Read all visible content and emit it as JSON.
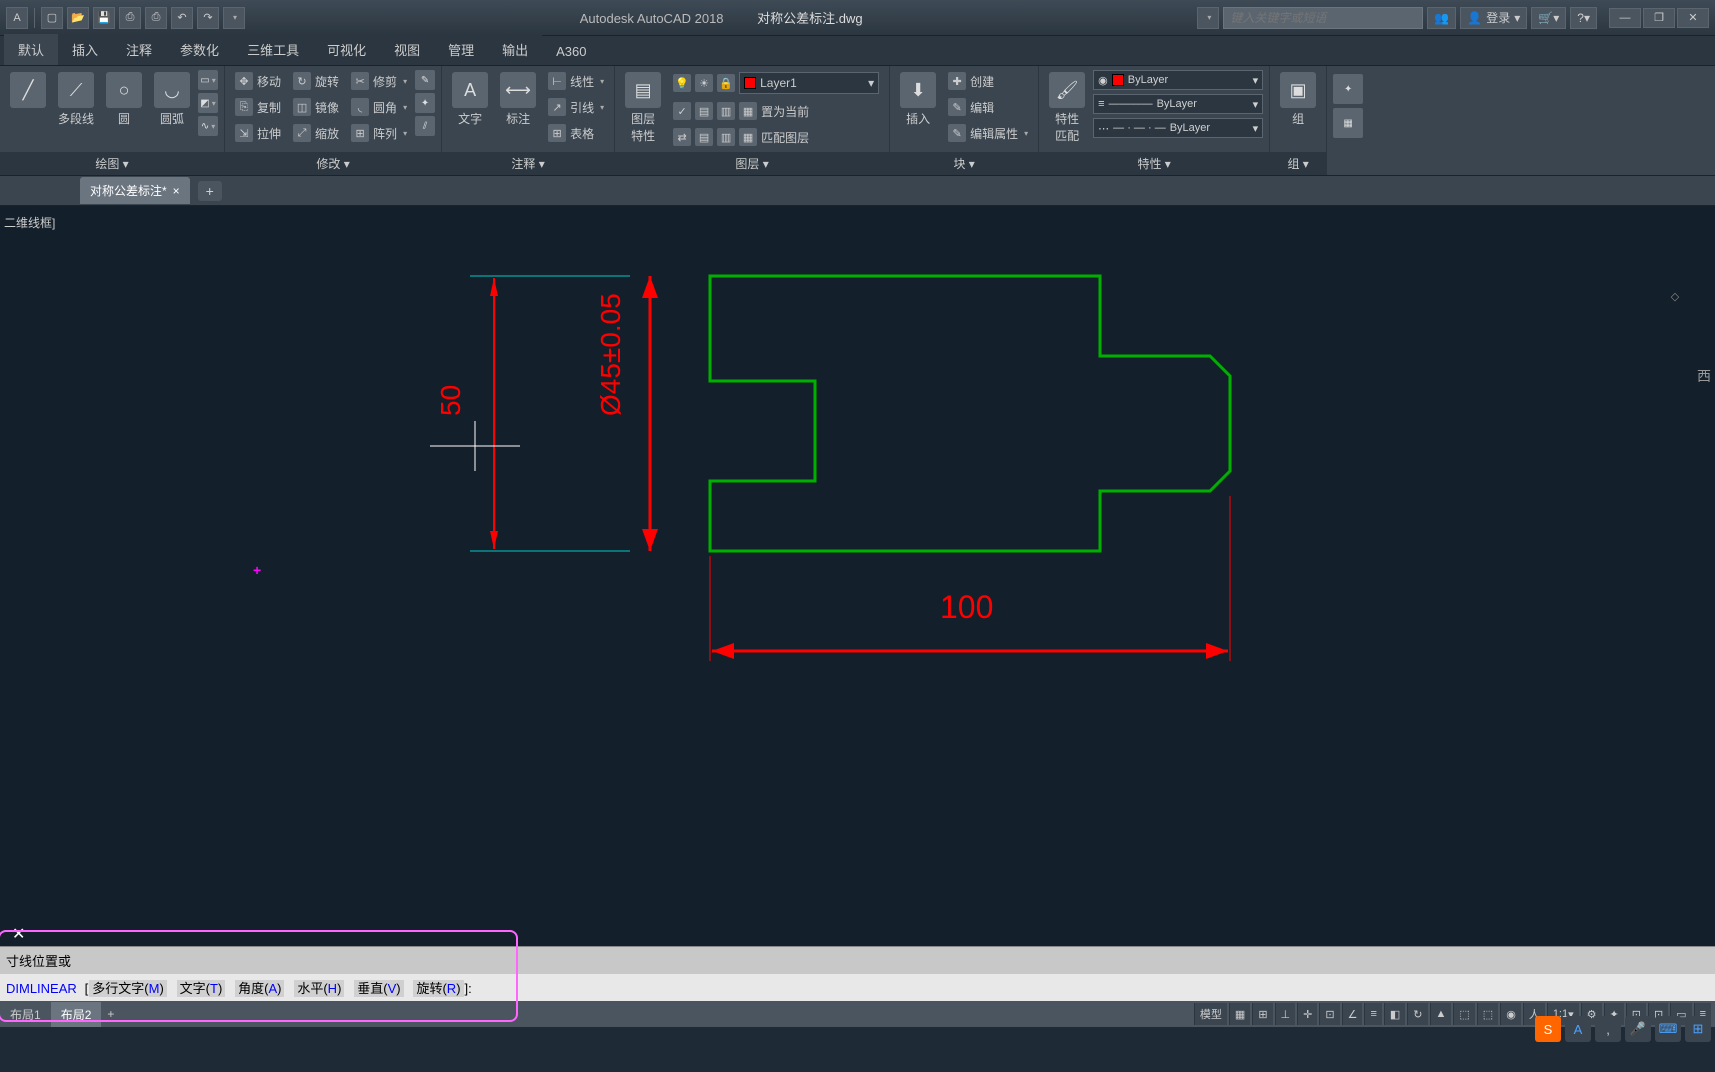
{
  "title": {
    "app": "Autodesk AutoCAD 2018",
    "doc": "对称公差标注.dwg"
  },
  "search": {
    "placeholder": "键入关键字或短语"
  },
  "login": {
    "label": "登录"
  },
  "tabs": [
    "默认",
    "插入",
    "注释",
    "参数化",
    "三维工具",
    "可视化",
    "视图",
    "管理",
    "输出",
    "A360"
  ],
  "ribbon": {
    "draw": {
      "title": "绘图 ▾",
      "btn1": "多段线",
      "btn2": "圆",
      "btn3": "圆弧"
    },
    "modify": {
      "title": "修改 ▾",
      "move": "移动",
      "rotate": "旋转",
      "trim": "修剪",
      "copy": "复制",
      "mirror": "镜像",
      "fillet": "圆角",
      "stretch": "拉伸",
      "scale": "缩放",
      "array": "阵列"
    },
    "annot": {
      "title": "注释 ▾",
      "text": "文字",
      "dim": "标注",
      "linear": "线性",
      "leader": "引线",
      "table": "表格"
    },
    "layer": {
      "title": "图层 ▾",
      "big": "图层\n特性",
      "name": "Layer1",
      "current": "置为当前",
      "match": "匹配图层"
    },
    "block": {
      "title": "块 ▾",
      "insert": "插入",
      "create": "创建",
      "edit": "编辑",
      "attr": "编辑属性"
    },
    "prop": {
      "title": "特性 ▾",
      "match": "特性\n匹配",
      "bylayer": "ByLayer",
      "bylayer2": "ByLayer",
      "bylayer3": "ByLayer"
    },
    "group": {
      "title": "组 ▾",
      "group": "组"
    }
  },
  "filetab": {
    "name": "对称公差标注*"
  },
  "viewport": {
    "style": "二维线框]"
  },
  "dims": {
    "d50": "50",
    "d45": "Ø45±0.05",
    "d100": "100"
  },
  "cmd": {
    "hist": "寸线位置或",
    "cmd": "DIMLINEAR",
    "opts": [
      "多行文字",
      "文字",
      "角度",
      "水平",
      "垂直",
      "旋转"
    ],
    "keys": [
      "M",
      "T",
      "A",
      "H",
      "V",
      "R"
    ]
  },
  "layouts": {
    "l1": "布局1",
    "l2": "布局2"
  },
  "status": {
    "model": "模型",
    "scale": "1:1"
  },
  "navcube": "西"
}
